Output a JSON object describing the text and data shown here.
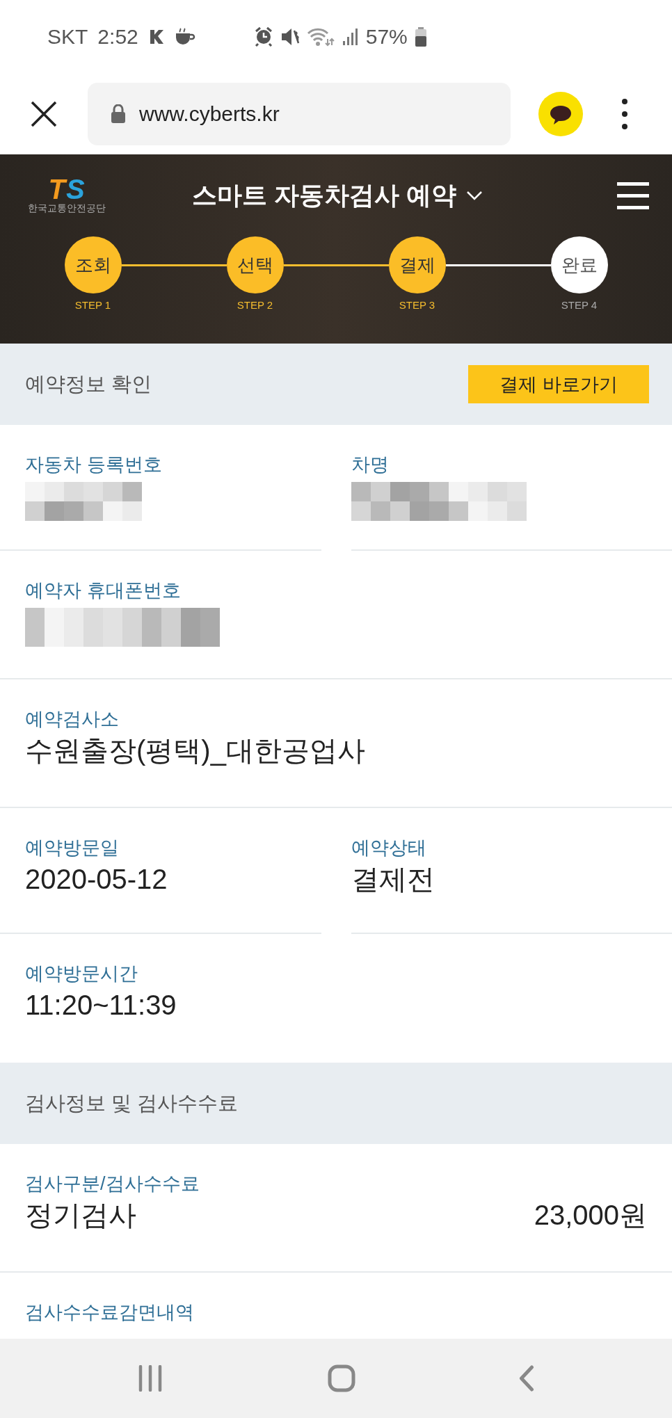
{
  "status_bar": {
    "carrier": "SKT",
    "time": "2:52",
    "battery": "57%"
  },
  "browser": {
    "url": "www.cyberts.kr"
  },
  "header": {
    "logo": "TS",
    "logo_caption": "한국교통안전공단",
    "title": "스마트 자동차검사 예약"
  },
  "steps": [
    {
      "label": "조회",
      "step": "STEP 1",
      "done": true
    },
    {
      "label": "선택",
      "step": "STEP 2",
      "done": true
    },
    {
      "label": "결제",
      "step": "STEP 3",
      "done": true
    },
    {
      "label": "완료",
      "step": "STEP 4",
      "done": false
    }
  ],
  "sections": [
    {
      "title": "예약정보 확인",
      "button": "결제 바로가기",
      "rows": [
        [
          {
            "label": "자동차 등록번호",
            "kind": "redacted"
          },
          {
            "label": "차명",
            "kind": "redacted"
          }
        ],
        [
          {
            "label": "예약자 휴대폰번호",
            "kind": "redacted"
          }
        ],
        [
          {
            "label": "예약검사소",
            "kind": "text",
            "value": "수원출장(평택)_대한공업사"
          }
        ],
        [
          {
            "label": "예약방문일",
            "kind": "text",
            "value": "2020-05-12"
          },
          {
            "label": "예약상태",
            "kind": "text",
            "value": "결제전"
          }
        ],
        [
          {
            "label": "예약방문시간",
            "kind": "text",
            "value": "11:20~11:39"
          }
        ]
      ]
    },
    {
      "title": "검사정보 및 검사수수료",
      "rows": [
        [
          {
            "label": "검사구분/검사수수료",
            "kind": "amount",
            "value": "정기검사",
            "amount": "23,000원"
          }
        ],
        [
          {
            "label": "검사수수료감면내역",
            "kind": "label"
          }
        ]
      ]
    }
  ]
}
